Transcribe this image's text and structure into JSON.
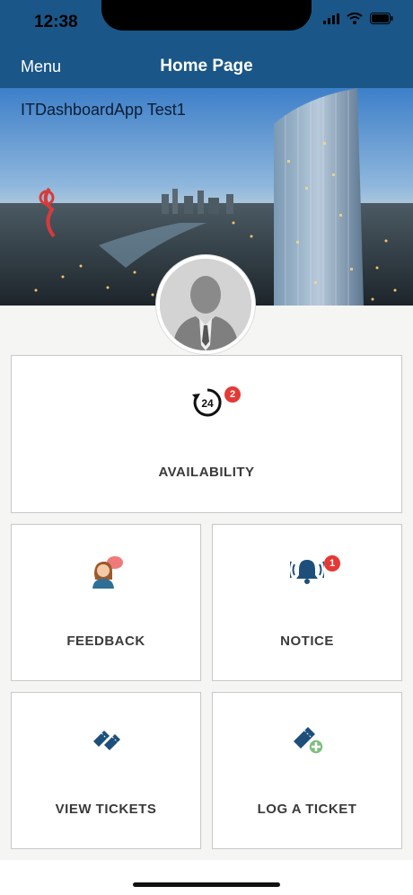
{
  "status": {
    "time": "12:38"
  },
  "nav": {
    "menu_label": "Menu",
    "title": "Home Page"
  },
  "banner": {
    "caption": "ITDashboardApp Test1"
  },
  "tiles": {
    "availability": {
      "label": "AVAILABILITY",
      "badge": "2",
      "icon": "24-hour-icon"
    },
    "feedback": {
      "label": "FEEDBACK",
      "icon": "feedback-person-icon"
    },
    "notice": {
      "label": "NOTICE",
      "badge": "1",
      "icon": "bell-icon"
    },
    "view_tickets": {
      "label": "VIEW TICKETS",
      "icon": "tickets-icon"
    },
    "log_ticket": {
      "label": "LOG A TICKET",
      "icon": "add-ticket-icon"
    }
  },
  "colors": {
    "nav": "#1a5688",
    "badge": "#e53935",
    "icon_blue": "#1d4f7a",
    "background": "#f5f5f3"
  }
}
